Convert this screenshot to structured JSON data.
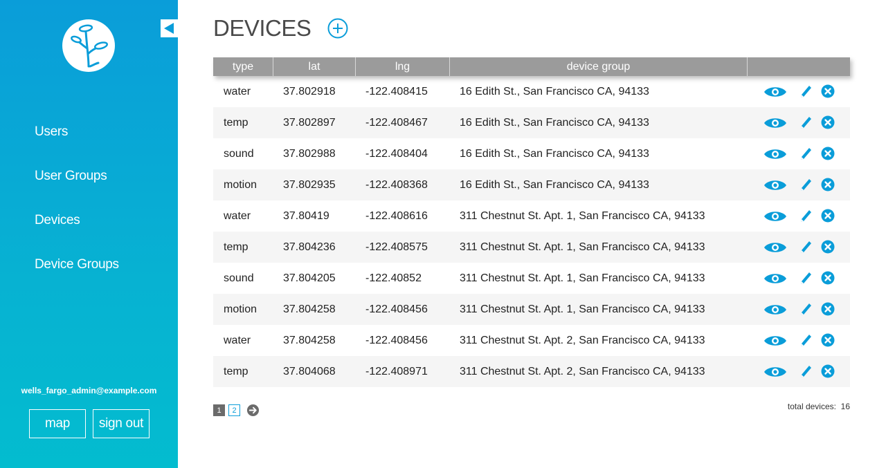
{
  "sidebar": {
    "nav": [
      {
        "label": "Users"
      },
      {
        "label": "User Groups"
      },
      {
        "label": "Devices"
      },
      {
        "label": "Device Groups"
      }
    ],
    "user_email": "wells_fargo_admin@example.com",
    "map_label": "map",
    "signout_label": "sign out"
  },
  "main": {
    "title": "DEVICES",
    "columns": [
      "type",
      "lat",
      "lng",
      "device group",
      ""
    ],
    "rows": [
      {
        "type": "water",
        "lat": "37.802918",
        "lng": "-122.408415",
        "group": "16 Edith St., San Francisco CA, 94133"
      },
      {
        "type": "temp",
        "lat": "37.802897",
        "lng": "-122.408467",
        "group": "16 Edith St., San Francisco CA, 94133"
      },
      {
        "type": "sound",
        "lat": "37.802988",
        "lng": "-122.408404",
        "group": "16 Edith St., San Francisco CA, 94133"
      },
      {
        "type": "motion",
        "lat": "37.802935",
        "lng": "-122.408368",
        "group": "16 Edith St., San Francisco CA, 94133"
      },
      {
        "type": "water",
        "lat": "37.80419",
        "lng": "-122.408616",
        "group": "311 Chestnut St. Apt. 1, San Francisco CA, 94133"
      },
      {
        "type": "temp",
        "lat": "37.804236",
        "lng": "-122.408575",
        "group": "311 Chestnut St. Apt. 1, San Francisco CA, 94133"
      },
      {
        "type": "sound",
        "lat": "37.804205",
        "lng": "-122.40852",
        "group": "311 Chestnut St. Apt. 1, San Francisco CA, 94133"
      },
      {
        "type": "motion",
        "lat": "37.804258",
        "lng": "-122.408456",
        "group": "311 Chestnut St. Apt. 1, San Francisco CA, 94133"
      },
      {
        "type": "water",
        "lat": "37.804258",
        "lng": "-122.408456",
        "group": "311 Chestnut St. Apt. 2, San Francisco CA, 94133"
      },
      {
        "type": "temp",
        "lat": "37.804068",
        "lng": "-122.408971",
        "group": "311 Chestnut St. Apt. 2, San Francisco CA, 94133"
      }
    ],
    "pagination": {
      "pages": [
        "1",
        "2"
      ],
      "current": "1"
    },
    "total_label": "total devices:",
    "total_value": "16"
  },
  "colors": {
    "accent": "#0a9dd9",
    "header_gray": "#9b9b9b"
  },
  "icons": {
    "eye": "eye-icon",
    "edit": "pencil-icon",
    "delete": "close-circle-icon",
    "add": "plus-circle-icon",
    "next": "arrow-right-circle-icon",
    "collapse": "triangle-left-icon"
  }
}
